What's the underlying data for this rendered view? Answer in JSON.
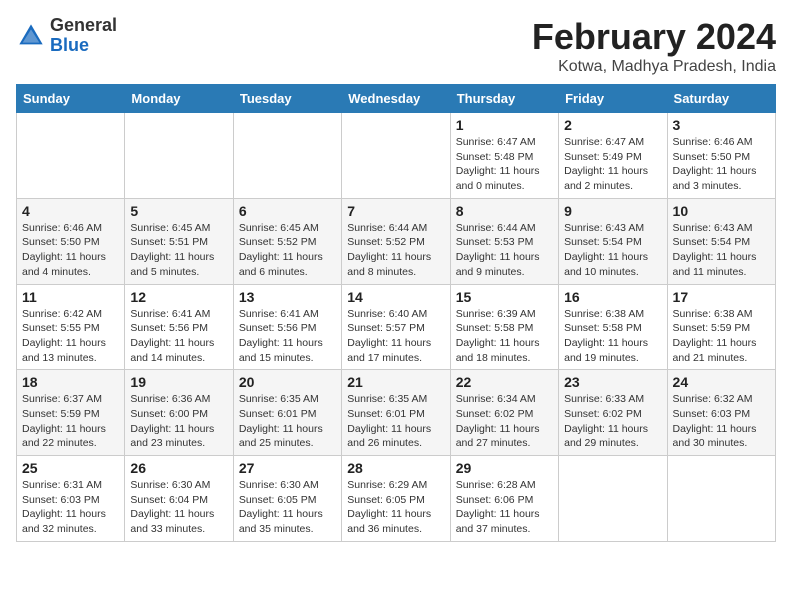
{
  "header": {
    "logo_general": "General",
    "logo_blue": "Blue",
    "month_title": "February 2024",
    "subtitle": "Kotwa, Madhya Pradesh, India"
  },
  "weekdays": [
    "Sunday",
    "Monday",
    "Tuesday",
    "Wednesday",
    "Thursday",
    "Friday",
    "Saturday"
  ],
  "weeks": [
    [
      {
        "day": "",
        "text": ""
      },
      {
        "day": "",
        "text": ""
      },
      {
        "day": "",
        "text": ""
      },
      {
        "day": "",
        "text": ""
      },
      {
        "day": "1",
        "text": "Sunrise: 6:47 AM\nSunset: 5:48 PM\nDaylight: 11 hours and 0 minutes."
      },
      {
        "day": "2",
        "text": "Sunrise: 6:47 AM\nSunset: 5:49 PM\nDaylight: 11 hours and 2 minutes."
      },
      {
        "day": "3",
        "text": "Sunrise: 6:46 AM\nSunset: 5:50 PM\nDaylight: 11 hours and 3 minutes."
      }
    ],
    [
      {
        "day": "4",
        "text": "Sunrise: 6:46 AM\nSunset: 5:50 PM\nDaylight: 11 hours and 4 minutes."
      },
      {
        "day": "5",
        "text": "Sunrise: 6:45 AM\nSunset: 5:51 PM\nDaylight: 11 hours and 5 minutes."
      },
      {
        "day": "6",
        "text": "Sunrise: 6:45 AM\nSunset: 5:52 PM\nDaylight: 11 hours and 6 minutes."
      },
      {
        "day": "7",
        "text": "Sunrise: 6:44 AM\nSunset: 5:52 PM\nDaylight: 11 hours and 8 minutes."
      },
      {
        "day": "8",
        "text": "Sunrise: 6:44 AM\nSunset: 5:53 PM\nDaylight: 11 hours and 9 minutes."
      },
      {
        "day": "9",
        "text": "Sunrise: 6:43 AM\nSunset: 5:54 PM\nDaylight: 11 hours and 10 minutes."
      },
      {
        "day": "10",
        "text": "Sunrise: 6:43 AM\nSunset: 5:54 PM\nDaylight: 11 hours and 11 minutes."
      }
    ],
    [
      {
        "day": "11",
        "text": "Sunrise: 6:42 AM\nSunset: 5:55 PM\nDaylight: 11 hours and 13 minutes."
      },
      {
        "day": "12",
        "text": "Sunrise: 6:41 AM\nSunset: 5:56 PM\nDaylight: 11 hours and 14 minutes."
      },
      {
        "day": "13",
        "text": "Sunrise: 6:41 AM\nSunset: 5:56 PM\nDaylight: 11 hours and 15 minutes."
      },
      {
        "day": "14",
        "text": "Sunrise: 6:40 AM\nSunset: 5:57 PM\nDaylight: 11 hours and 17 minutes."
      },
      {
        "day": "15",
        "text": "Sunrise: 6:39 AM\nSunset: 5:58 PM\nDaylight: 11 hours and 18 minutes."
      },
      {
        "day": "16",
        "text": "Sunrise: 6:38 AM\nSunset: 5:58 PM\nDaylight: 11 hours and 19 minutes."
      },
      {
        "day": "17",
        "text": "Sunrise: 6:38 AM\nSunset: 5:59 PM\nDaylight: 11 hours and 21 minutes."
      }
    ],
    [
      {
        "day": "18",
        "text": "Sunrise: 6:37 AM\nSunset: 5:59 PM\nDaylight: 11 hours and 22 minutes."
      },
      {
        "day": "19",
        "text": "Sunrise: 6:36 AM\nSunset: 6:00 PM\nDaylight: 11 hours and 23 minutes."
      },
      {
        "day": "20",
        "text": "Sunrise: 6:35 AM\nSunset: 6:01 PM\nDaylight: 11 hours and 25 minutes."
      },
      {
        "day": "21",
        "text": "Sunrise: 6:35 AM\nSunset: 6:01 PM\nDaylight: 11 hours and 26 minutes."
      },
      {
        "day": "22",
        "text": "Sunrise: 6:34 AM\nSunset: 6:02 PM\nDaylight: 11 hours and 27 minutes."
      },
      {
        "day": "23",
        "text": "Sunrise: 6:33 AM\nSunset: 6:02 PM\nDaylight: 11 hours and 29 minutes."
      },
      {
        "day": "24",
        "text": "Sunrise: 6:32 AM\nSunset: 6:03 PM\nDaylight: 11 hours and 30 minutes."
      }
    ],
    [
      {
        "day": "25",
        "text": "Sunrise: 6:31 AM\nSunset: 6:03 PM\nDaylight: 11 hours and 32 minutes."
      },
      {
        "day": "26",
        "text": "Sunrise: 6:30 AM\nSunset: 6:04 PM\nDaylight: 11 hours and 33 minutes."
      },
      {
        "day": "27",
        "text": "Sunrise: 6:30 AM\nSunset: 6:05 PM\nDaylight: 11 hours and 35 minutes."
      },
      {
        "day": "28",
        "text": "Sunrise: 6:29 AM\nSunset: 6:05 PM\nDaylight: 11 hours and 36 minutes."
      },
      {
        "day": "29",
        "text": "Sunrise: 6:28 AM\nSunset: 6:06 PM\nDaylight: 11 hours and 37 minutes."
      },
      {
        "day": "",
        "text": ""
      },
      {
        "day": "",
        "text": ""
      }
    ]
  ]
}
